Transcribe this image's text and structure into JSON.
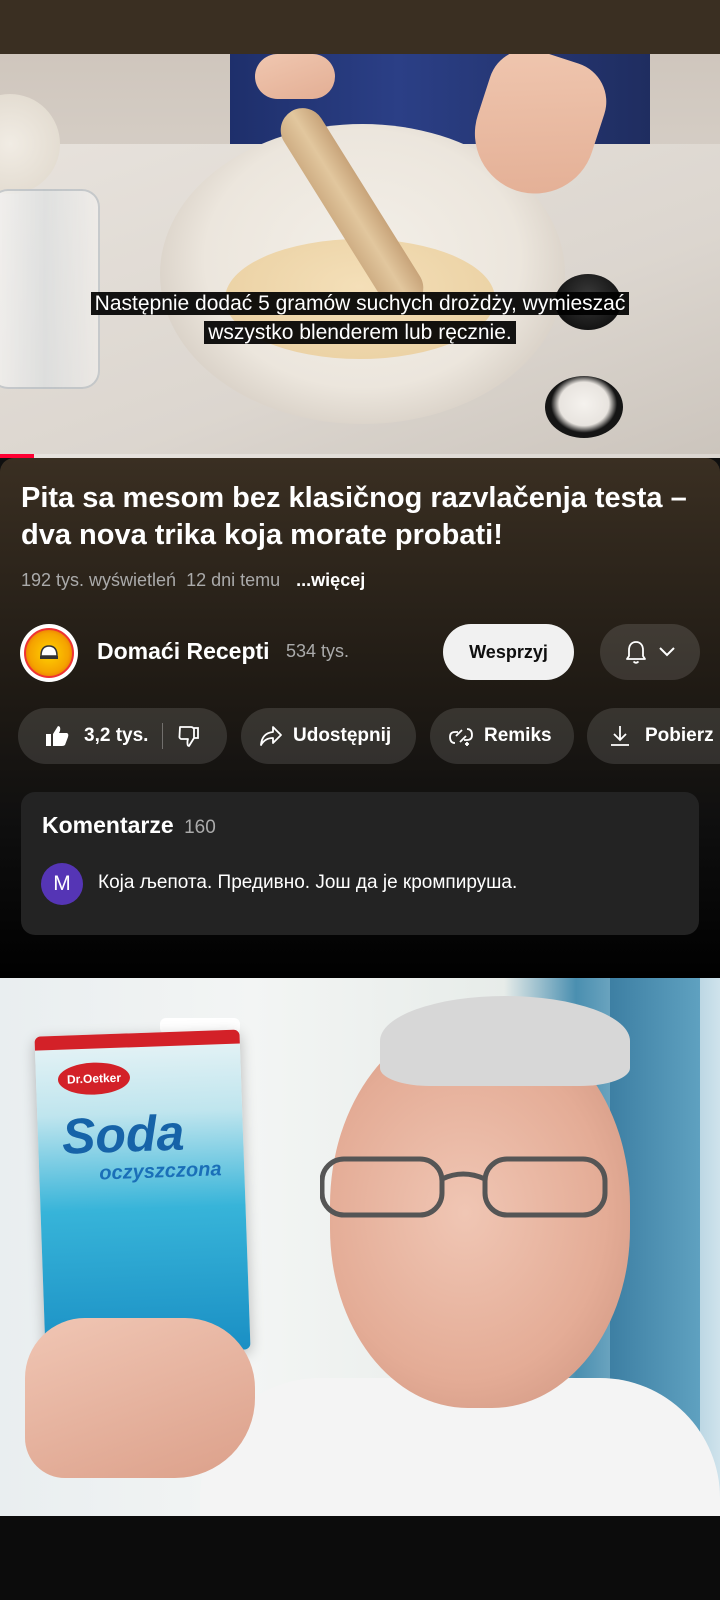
{
  "video": {
    "caption_line1": "Następnie dodać 5 gramów suchych drożdży, wymieszać",
    "caption_line2": "wszystko blenderem lub ręcznie.",
    "progress_fraction": 0.047
  },
  "details": {
    "title": "Pita sa mesom bez klasičnog razvlačenja testa – dva nova trika koja morate probati!",
    "views": "192 tys. wyświetleń",
    "age": "12 dni temu",
    "more_label": "...więcej"
  },
  "channel": {
    "name": "Domaći Recepti",
    "subscribers": "534 tys.",
    "support_label": "Wesprzyj",
    "bell_icon": "bell-icon"
  },
  "actions": {
    "likes": "3,2 tys.",
    "share_label": "Udostępnij",
    "remix_label": "Remiks",
    "download_label": "Pobierz"
  },
  "comments": {
    "label": "Komentarze",
    "count": "160",
    "first_author_initial": "M",
    "first_text": "Која љепота. Предивно. Још да је кромпируша."
  },
  "ad": {
    "brand": "Dr.Oetker",
    "product_main": "Soda",
    "product_sub": "oczyszczona"
  },
  "colors": {
    "accent_red": "#ff0033",
    "header_brown": "#3a2f22",
    "comment_avatar": "#5535b5"
  }
}
